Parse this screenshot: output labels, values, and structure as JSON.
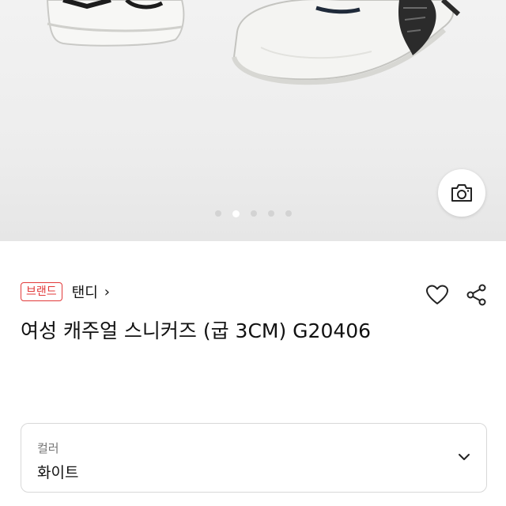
{
  "product": {
    "brand_badge": "브랜드",
    "brand_name": "탠디",
    "brand_chevron": "›",
    "title": "여성 캐주얼 스니커즈 (굽 3CM) G20406"
  },
  "gallery": {
    "image_count": 5,
    "active_index": 1,
    "camera_icon": "camera-icon"
  },
  "actions": {
    "wishlist_icon": "heart-outline-icon",
    "share_icon": "share-icon"
  },
  "option": {
    "label": "컬러",
    "value": "화이트",
    "dropdown_icon": "chevron-down-icon"
  }
}
